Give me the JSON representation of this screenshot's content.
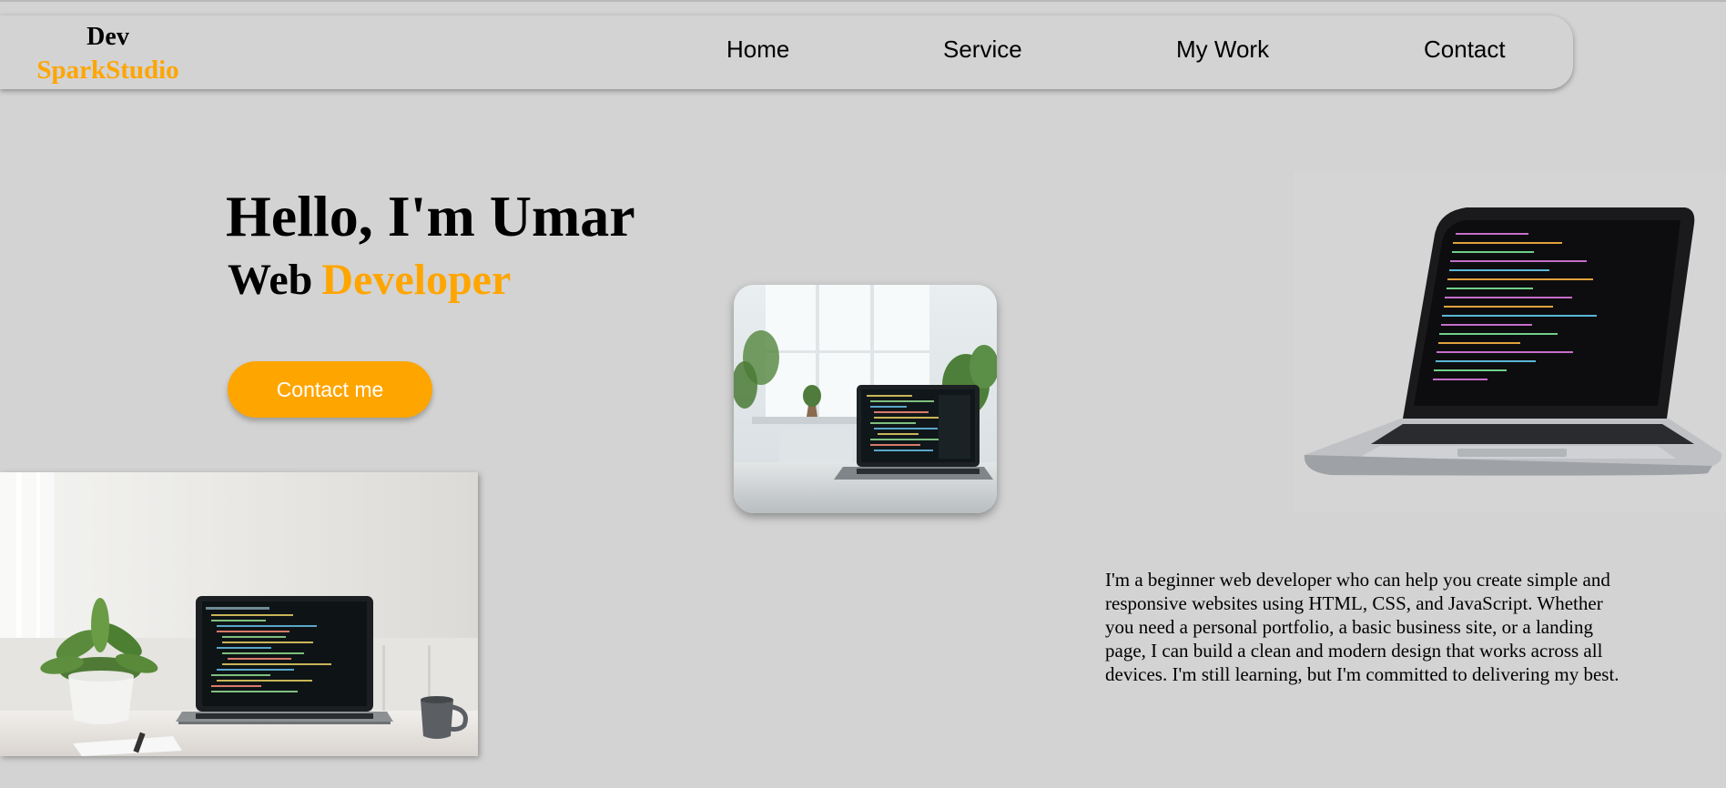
{
  "logo": {
    "line1": "Dev",
    "line2": "SparkStudio"
  },
  "nav": {
    "items": [
      "Home",
      "Service",
      "My Work",
      "Contact"
    ]
  },
  "hero": {
    "title": "Hello, I'm Umar",
    "subtitle_word1": "Web",
    "subtitle_word2": "Developer",
    "button_label": "Contact me"
  },
  "about": {
    "text": "I'm a beginner web developer who can help you create simple and responsive websites using HTML, CSS, and JavaScript. Whether you need a personal portfolio, a basic business site, or a landing page, I can build a clean and modern design that works across all devices. I'm still learning, but I'm committed to delivering my best."
  },
  "colors": {
    "background": "#d3d3d3",
    "accent": "#ffa500",
    "text": "#000000",
    "button_text": "#ffffff"
  }
}
